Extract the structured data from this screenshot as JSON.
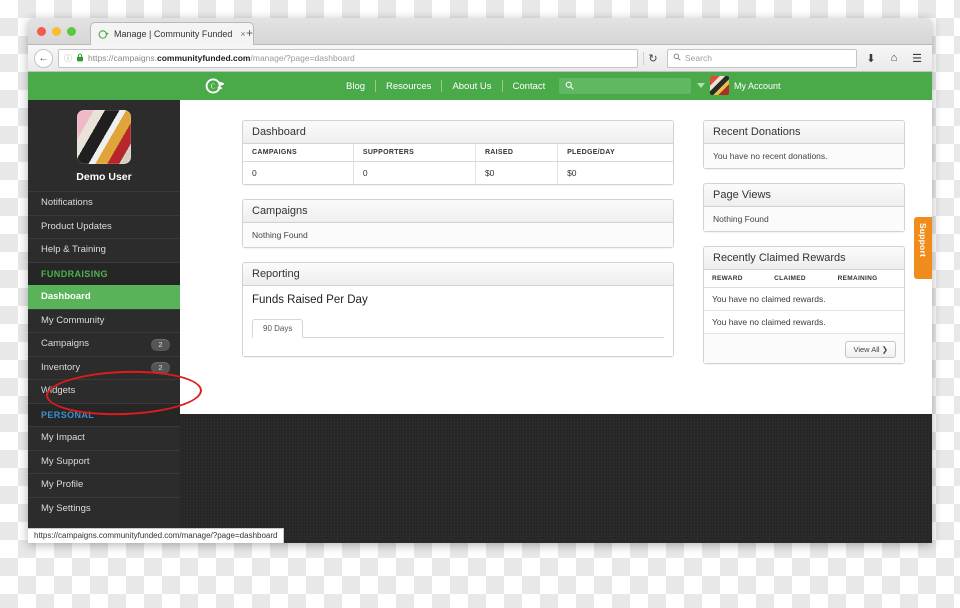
{
  "browser": {
    "tab": {
      "title": "Manage | Community Funded",
      "favicon": "leaf-icon",
      "close": "×"
    },
    "new_tab": "+",
    "back_icon": "←",
    "info_icon": "ⓘ",
    "lock_icon": "🔒",
    "url": {
      "scheme": "https://campaigns.",
      "domain": "communityfunded.com",
      "path": "/manage/?page=dashboard"
    },
    "reload_icon": "↻",
    "search": {
      "placeholder": "Search",
      "icon": "search-icon"
    },
    "download_icon": "⬇",
    "home_icon": "⌂",
    "menu_icon": "☰"
  },
  "topnav": {
    "logo": "community-funded-leaf-logo",
    "links": [
      "Blog",
      "Resources",
      "About Us",
      "Contact"
    ],
    "search_placeholder": "",
    "account_label": "My Account",
    "caret": "chevron-down-icon"
  },
  "sidebar": {
    "profile_name": "Demo User",
    "items": [
      {
        "label": "Notifications",
        "type": "link"
      },
      {
        "label": "Product Updates",
        "type": "link"
      },
      {
        "label": "Help & Training",
        "type": "link"
      },
      {
        "label": "FUNDRAISING",
        "type": "section"
      },
      {
        "label": "Dashboard",
        "type": "link",
        "active": true
      },
      {
        "label": "My Community",
        "type": "link",
        "annotated": true
      },
      {
        "label": "Campaigns",
        "type": "link",
        "badge": "2"
      },
      {
        "label": "Inventory",
        "type": "link",
        "badge": "2"
      },
      {
        "label": "Widgets",
        "type": "link"
      },
      {
        "label": "PERSONAL",
        "type": "section",
        "accent": "blue"
      },
      {
        "label": "My Impact",
        "type": "link"
      },
      {
        "label": "My Support",
        "type": "link"
      },
      {
        "label": "My Profile",
        "type": "link"
      },
      {
        "label": "My Settings",
        "type": "link"
      }
    ]
  },
  "dashboard_panel": {
    "title": "Dashboard",
    "columns": [
      "CAMPAIGNS",
      "SUPPORTERS",
      "RAISED",
      "PLEDGE/DAY"
    ],
    "values": [
      "0",
      "0",
      "$0",
      "$0"
    ]
  },
  "campaigns_panel": {
    "title": "Campaigns",
    "empty_text": "Nothing Found"
  },
  "reporting_panel": {
    "title": "Reporting",
    "report_title": "Funds Raised Per Day",
    "tab_label": "90 Days"
  },
  "recent_donations": {
    "title": "Recent Donations",
    "empty_text": "You have no recent donations."
  },
  "page_views": {
    "title": "Page Views",
    "empty_text": "Nothing Found"
  },
  "rewards": {
    "title": "Recently Claimed Rewards",
    "columns": [
      "REWARD",
      "CLAIMED",
      "REMAINING"
    ],
    "rows": [
      "You have no claimed rewards.",
      "You have no claimed rewards."
    ],
    "view_all_label": "View All",
    "view_all_icon": "❯"
  },
  "support_tab": {
    "label": "Support",
    "color": "#ef8c1c"
  },
  "status_bar": {
    "url": "https://campaigns.communityfunded.com/manage/?page=dashboard"
  },
  "colors": {
    "brand_green": "#4aaa4a",
    "active_green": "#59b359",
    "section_green": "#4fb34f",
    "section_blue": "#3f8fd0",
    "sidebar_dark": "#2c2c2c",
    "annotation_red": "#e01b1b",
    "support_orange": "#ef8c1c"
  }
}
